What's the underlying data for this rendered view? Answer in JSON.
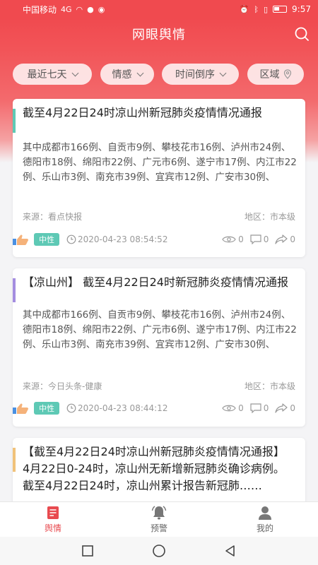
{
  "status_bar": {
    "carrier": "中国移动",
    "signal": "4G",
    "time": "9:57"
  },
  "header": {
    "title": "网眼舆情"
  },
  "filters": [
    {
      "label": "最近七天"
    },
    {
      "label": "情感"
    },
    {
      "label": "时间倒序"
    },
    {
      "label": "区域"
    }
  ],
  "colors": {
    "brand": "#f04a4f",
    "neutral_badge": "#5ec9b5"
  },
  "cards": [
    {
      "accent": "#5ec9b5",
      "title": "截至4月22日24时凉山州新冠肺炎疫情情况通报",
      "body": "其中成都市166例、自贡市9例、攀枝花市16例、泸州市24例、德阳市18例、绵阳市22例、广元市6例、遂宁市17例、内江市22例、乐山市3例、南充市39例、宜宾市12例、广安市30例、",
      "source": "来源：看点快报",
      "region": "地区：市本级",
      "sentiment": "中性",
      "time": "2020-04-23 08:54:52",
      "views": "0",
      "comments": "0",
      "shares": "0"
    },
    {
      "accent": "#a48de0",
      "title": "【凉山州】 截至4月22日24时新冠肺炎疫情情况通报",
      "body": "其中成都市166例、自贡市9例、攀枝花市16例、泸州市24例、德阳市18例、绵阳市22例、广元市6例、遂宁市17例、内江市22例、乐山市3例、南充市39例、宜宾市12例、广安市30例、",
      "source": "来源：今日头条-健康",
      "region": "地区：市本级",
      "sentiment": "中性",
      "time": "2020-04-23 08:44:12",
      "views": "0",
      "comments": "0",
      "shares": "0"
    },
    {
      "accent": "#f1c27a",
      "title": "【截至4月22日24时凉山州新冠肺炎疫情情况通报】 4月22日0-24时，凉山州无新增新冠肺炎确诊病例。截至4月22日24时，凉山州累计报告新冠肺……"
    }
  ],
  "bottom_nav": [
    {
      "label": "舆情",
      "icon": "news-icon",
      "active": true
    },
    {
      "label": "预警",
      "icon": "bell-icon",
      "active": false
    },
    {
      "label": "我的",
      "icon": "user-icon",
      "active": false
    }
  ]
}
